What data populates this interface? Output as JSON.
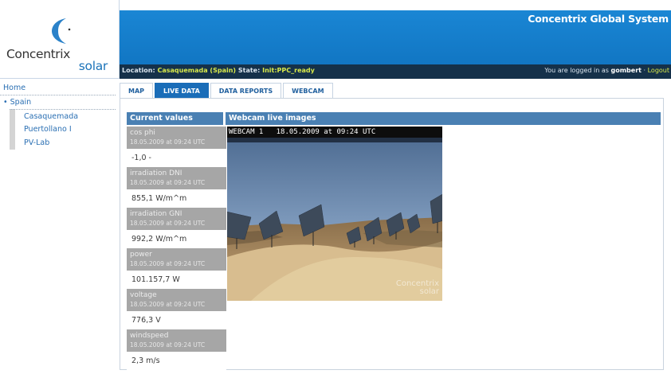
{
  "logo": {
    "word1": "Concentrix",
    "word2": "solar"
  },
  "header": {
    "system_title": "Concentrix Global System",
    "location_label": "Location:",
    "location_value": "Casaquemada (Spain)",
    "state_label": "State:",
    "state_value": "Init:PPC_ready",
    "login_prefix": "You are logged in as",
    "login_user": "gombert",
    "separator": "·",
    "logout": "Logout"
  },
  "nav": {
    "home": "Home",
    "country": "Spain",
    "bullet": "•",
    "sites": [
      "Casaquemada",
      "Puertollano I",
      "PV-Lab"
    ]
  },
  "tabs": [
    {
      "label": "MAP",
      "active": false
    },
    {
      "label": "LIVE DATA",
      "active": true
    },
    {
      "label": "DATA REPORTS",
      "active": false
    },
    {
      "label": "WEBCAM",
      "active": false
    }
  ],
  "current_values": {
    "heading": "Current values",
    "items": [
      {
        "name": "cos phi",
        "time": "18.05.2009 at 09:24 UTC",
        "value": "-1,0 -"
      },
      {
        "name": "irradiation DNI",
        "time": "18.05.2009 at 09:24 UTC",
        "value": "855,1 W/m^m"
      },
      {
        "name": "irradiation GNI",
        "time": "18.05.2009 at 09:24 UTC",
        "value": "992,2 W/m^m"
      },
      {
        "name": "power",
        "time": "18.05.2009 at 09:24 UTC",
        "value": "101.157,7 W"
      },
      {
        "name": "voltage",
        "time": "18.05.2009 at 09:24 UTC",
        "value": "776,3 V"
      },
      {
        "name": "windspeed",
        "time": "18.05.2009 at 09:24 UTC",
        "value": "2,3 m/s"
      }
    ]
  },
  "webcam": {
    "heading": "Webcam live images",
    "camera_name": "WEBCAM 1",
    "timestamp": "18.05.2009 at 09:24 UTC",
    "watermark_word1": "Concentrix",
    "watermark_word2": "solar"
  },
  "colors": {
    "brand_blue": "#1a86d4",
    "status_bar": "#15314a",
    "highlight": "#d7e84a",
    "active_tab": "#1a6db8",
    "section_header": "#4a80b3",
    "value_label_bg": "#a6a6a6"
  }
}
